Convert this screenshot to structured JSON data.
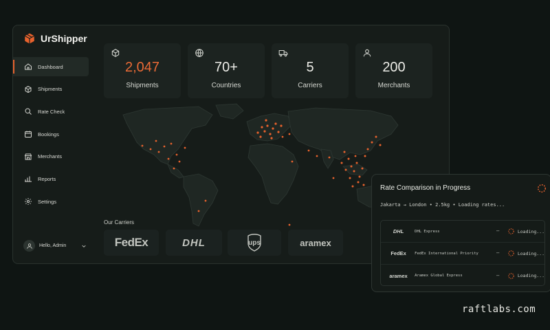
{
  "app": {
    "name": "UrShipper"
  },
  "sidebar": {
    "items": [
      {
        "label": "Dashboard",
        "icon": "home-icon",
        "active": true
      },
      {
        "label": "Shipments",
        "icon": "box-icon"
      },
      {
        "label": "Rate Check",
        "icon": "search-icon"
      },
      {
        "label": "Bookings",
        "icon": "calendar-icon"
      },
      {
        "label": "Merchants",
        "icon": "store-icon"
      },
      {
        "label": "Reports",
        "icon": "bar-chart-icon"
      },
      {
        "label": "Settings",
        "icon": "gear-icon"
      }
    ],
    "user_label": "Hello, Admin"
  },
  "stats": [
    {
      "value": "2,047",
      "label": "Shipments",
      "icon": "box-icon"
    },
    {
      "value": "70+",
      "label": "Countries",
      "icon": "globe-icon"
    },
    {
      "value": "5",
      "label": "Carriers",
      "icon": "truck-icon"
    },
    {
      "value": "200",
      "label": "Merchants",
      "icon": "user-icon"
    }
  ],
  "carriers": {
    "title": "Our Carriers",
    "logos": [
      "FedEx",
      "DHL",
      "ups",
      "aramex"
    ]
  },
  "rate_panel": {
    "title": "Rate Comparison in Progress",
    "route": "Jakarta → London  •  2.5kg  •  Loading rates...",
    "rows": [
      {
        "logo": "DHL",
        "service": "DHL Express",
        "price": "--",
        "status": "Loading..."
      },
      {
        "logo": "FedEx",
        "service": "FedEx International Priority",
        "price": "--",
        "status": "Loading..."
      },
      {
        "logo": "aramex",
        "service": "Aramex Global Express",
        "price": "--",
        "status": "Loading..."
      }
    ]
  },
  "watermark": "raftlabs.com",
  "colors": {
    "accent": "#e8622d",
    "background": "#0f1513",
    "card": "#1c2320"
  }
}
